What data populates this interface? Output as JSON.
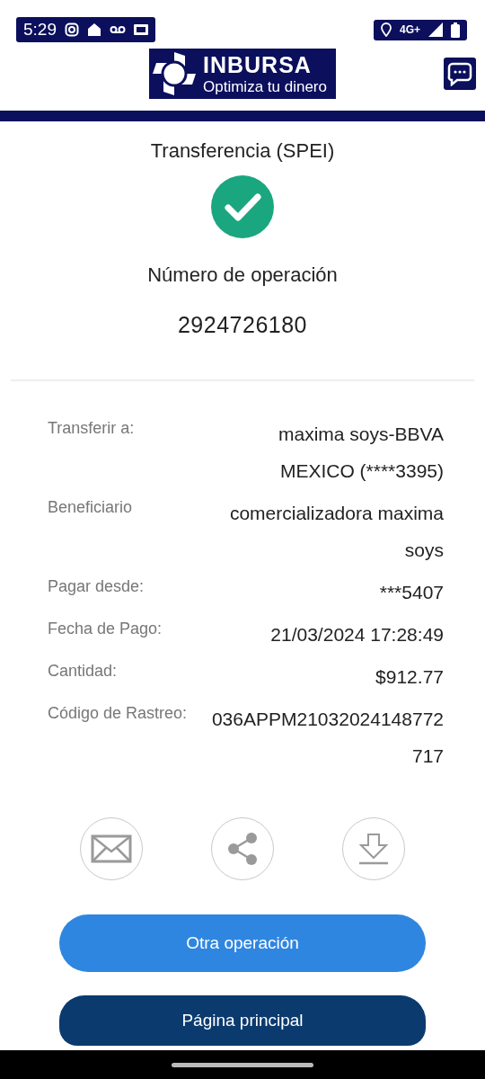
{
  "status_bar": {
    "time": "5:29",
    "network": "4G+"
  },
  "header": {
    "brand": "INBURSA",
    "tagline": "Optimiza tu dinero"
  },
  "receipt": {
    "title": "Transferencia (SPEI)",
    "operation_label": "Número de operación",
    "operation_number": "2924726180"
  },
  "details": [
    {
      "label": "Transferir a:",
      "value": "maxima soys-BBVA MEXICO (****3395)"
    },
    {
      "label": "Beneficiario",
      "value": "comercializadora maxima soys"
    },
    {
      "label": "Pagar desde:",
      "value": "***5407"
    },
    {
      "label": "Fecha de Pago:",
      "value": "21/03/2024 17:28:49"
    },
    {
      "label": "Cantidad:",
      "value": "$912.77"
    },
    {
      "label": "Código de Rastreo:",
      "value": "036APPM21032024148772717"
    }
  ],
  "actions": [
    {
      "kind": "email"
    },
    {
      "kind": "share"
    },
    {
      "kind": "download"
    }
  ],
  "buttons": [
    {
      "label": "Otra operación",
      "kind": "secondary"
    },
    {
      "label": "Página principal",
      "kind": "primary"
    }
  ]
}
